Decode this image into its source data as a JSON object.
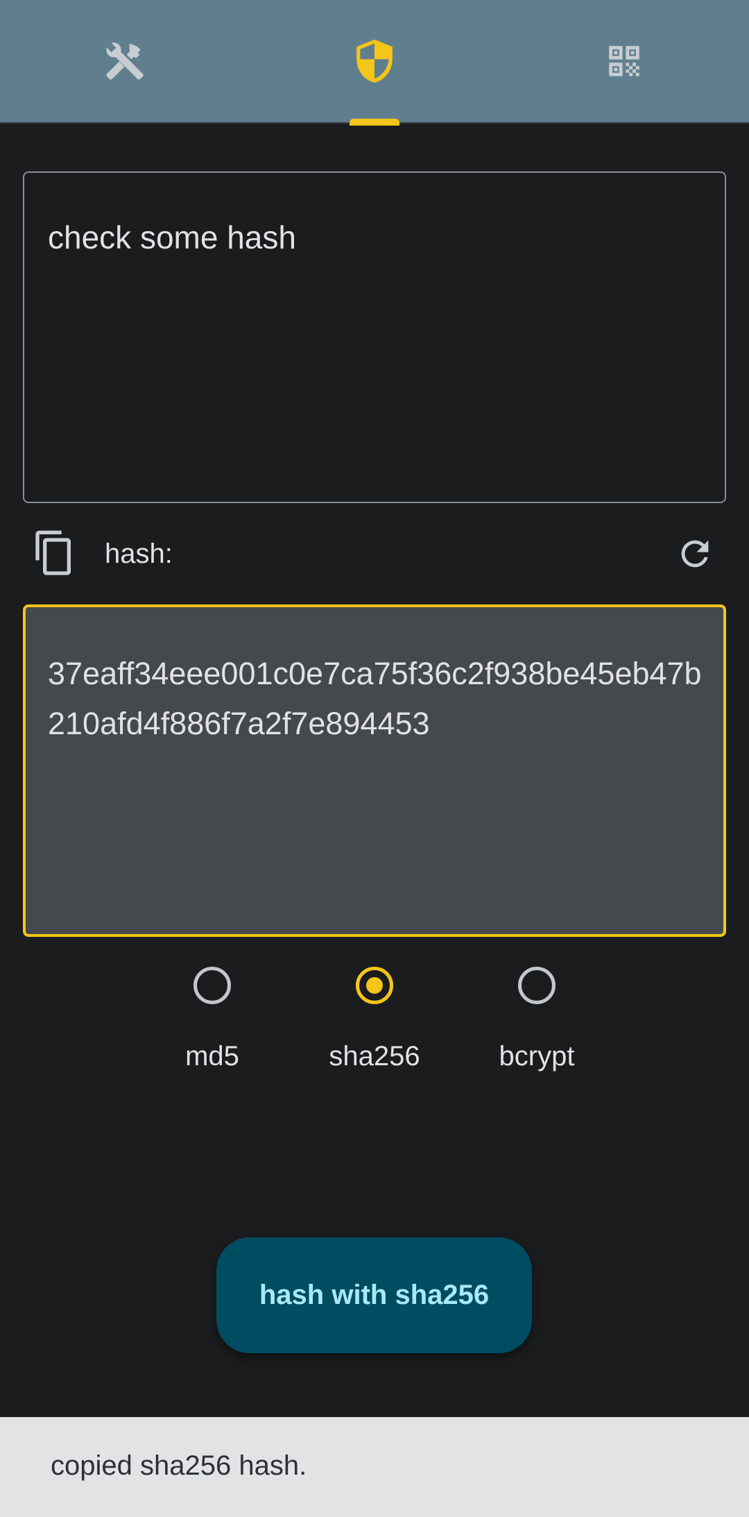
{
  "tabs": [
    {
      "icon": "tools-icon",
      "selected": false
    },
    {
      "icon": "security-shield-icon",
      "selected": true
    },
    {
      "icon": "qr-code-icon",
      "selected": false
    }
  ],
  "input": {
    "value": "check some hash"
  },
  "hash_row": {
    "label": "hash:",
    "copy_icon": "copy-icon",
    "refresh_icon": "refresh-icon"
  },
  "output": {
    "value": "37eaff34eee001c0e7ca75f36c2f938be45eb47b210afd4f886f7a2f7e894453"
  },
  "algorithms": [
    {
      "label": "md5",
      "selected": false
    },
    {
      "label": "sha256",
      "selected": true
    },
    {
      "label": "bcrypt",
      "selected": false
    }
  ],
  "action_button": {
    "label": "hash with sha256"
  },
  "snackbar": {
    "message": "copied sha256 hash."
  },
  "colors": {
    "appbar": "#5f7f8e",
    "accent": "#f5c518",
    "background": "#1a1c1e",
    "button": "#004c60",
    "button_text": "#a9e8f9"
  }
}
